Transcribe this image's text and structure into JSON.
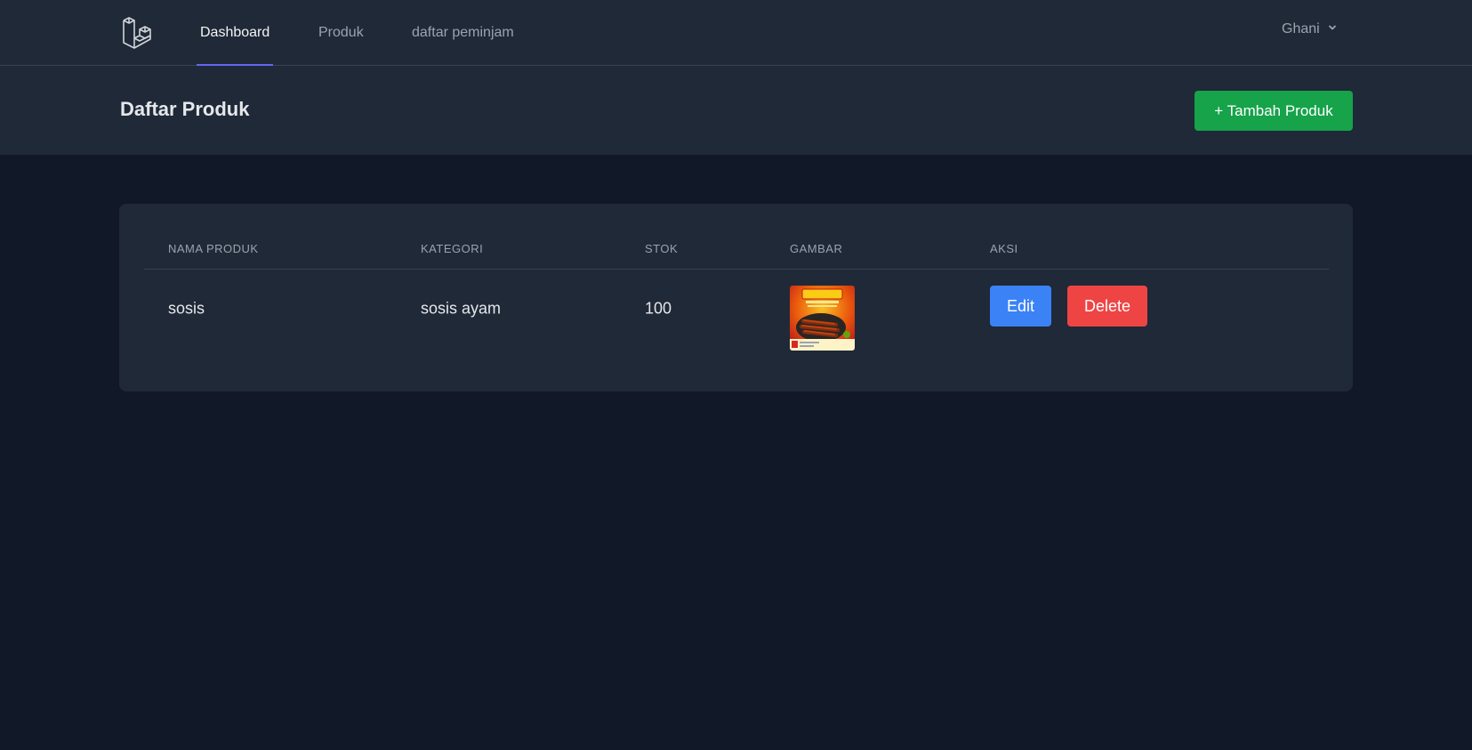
{
  "nav": {
    "links": [
      {
        "label": "Dashboard",
        "active": true
      },
      {
        "label": "Produk",
        "active": false
      },
      {
        "label": "daftar peminjam",
        "active": false
      }
    ],
    "user": {
      "name": "Ghani",
      "icon": "chevron-down-icon"
    },
    "logo_icon": "laravel-logo-icon"
  },
  "header": {
    "title": "Daftar Produk",
    "add_button_label": "+ Tambah Produk"
  },
  "table": {
    "columns": [
      "NAMA PRODUK",
      "KATEGORI",
      "STOK",
      "GAMBAR",
      "AKSI"
    ],
    "rows": [
      {
        "nama_produk": "sosis",
        "kategori": "sosis ayam",
        "stok": "100",
        "actions": {
          "edit": "Edit",
          "delete": "Delete"
        }
      }
    ]
  },
  "colors": {
    "background": "#111827",
    "panel": "#1f2937",
    "accent": "#6366f1",
    "success": "#16a34a",
    "primary": "#3b82f6",
    "danger": "#ef4444"
  }
}
